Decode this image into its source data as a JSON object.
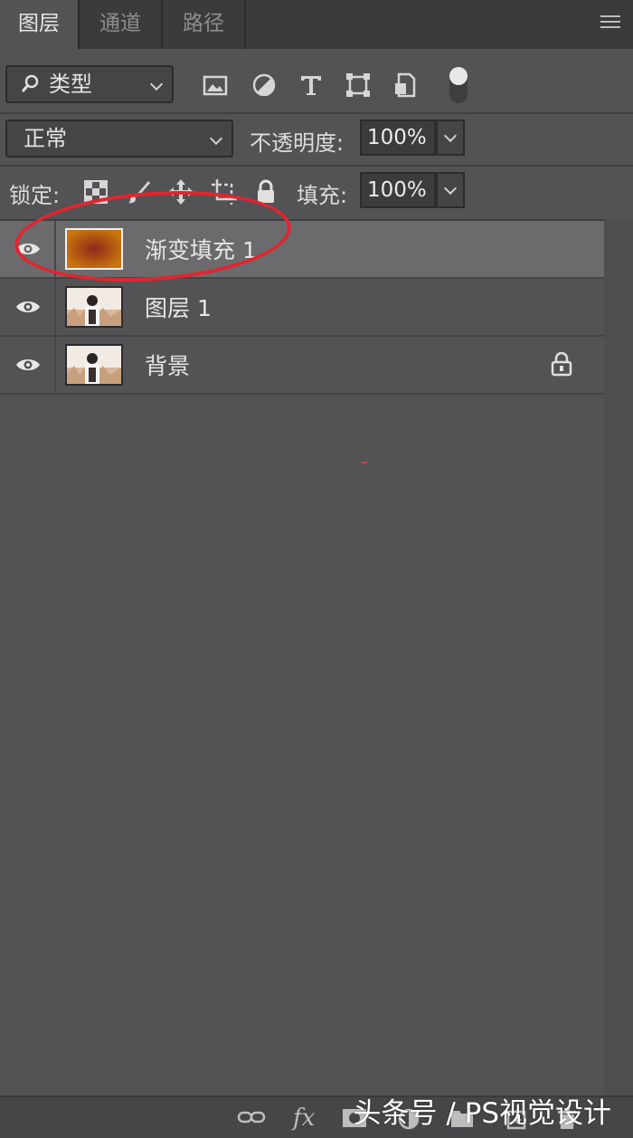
{
  "tabs": [
    {
      "label": "图层",
      "active": true
    },
    {
      "label": "通道",
      "active": false
    },
    {
      "label": "路径",
      "active": false
    }
  ],
  "filter": {
    "kind_label": "类型",
    "icons": [
      "image-filter-icon",
      "adjustment-filter-icon",
      "type-filter-icon",
      "shape-filter-icon",
      "smart-object-filter-icon",
      "filter-toggle-icon"
    ]
  },
  "blend": {
    "mode": "正常",
    "opacity_label": "不透明度:",
    "opacity_value": "100%"
  },
  "lock": {
    "label": "锁定:",
    "fill_label": "填充:",
    "fill_value": "100%"
  },
  "layers": [
    {
      "name": "渐变填充 1",
      "selected": true,
      "locked": false,
      "type": "gradient-fill"
    },
    {
      "name": "图层 1",
      "selected": false,
      "locked": false,
      "type": "photo"
    },
    {
      "name": "背景",
      "selected": false,
      "locked": true,
      "type": "photo"
    }
  ],
  "watermark": "头条号 / PS视觉设计",
  "colors": {
    "panel_bg": "#535254",
    "selected_row": "#6b6a6c",
    "annotation": "#e2252e",
    "gradient_outer": "#c8750f",
    "gradient_inner": "#8a2a1a"
  }
}
